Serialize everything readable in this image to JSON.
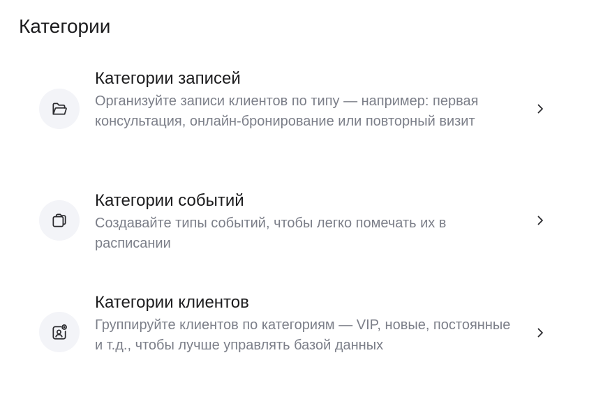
{
  "page": {
    "title": "Категории"
  },
  "items": [
    {
      "title": "Категории записей",
      "description": "Организуйте записи клиентов по типу — например: первая консультация, онлайн-бронирование или повторный визит",
      "icon": "folder-open-icon"
    },
    {
      "title": "Категории событий",
      "description": "Создавайте типы событий, чтобы легко помечать их в расписании",
      "icon": "stacked-folders-icon"
    },
    {
      "title": "Категории клиентов",
      "description": "Группируйте клиентов по категориям — VIP, новые, постоянные и т.д., чтобы лучше управлять базой данных",
      "icon": "client-badge-icon"
    }
  ],
  "colors": {
    "icon_background": "#f3f4f8",
    "text_primary": "#1c1c1e",
    "text_secondary": "#7c7f89"
  }
}
